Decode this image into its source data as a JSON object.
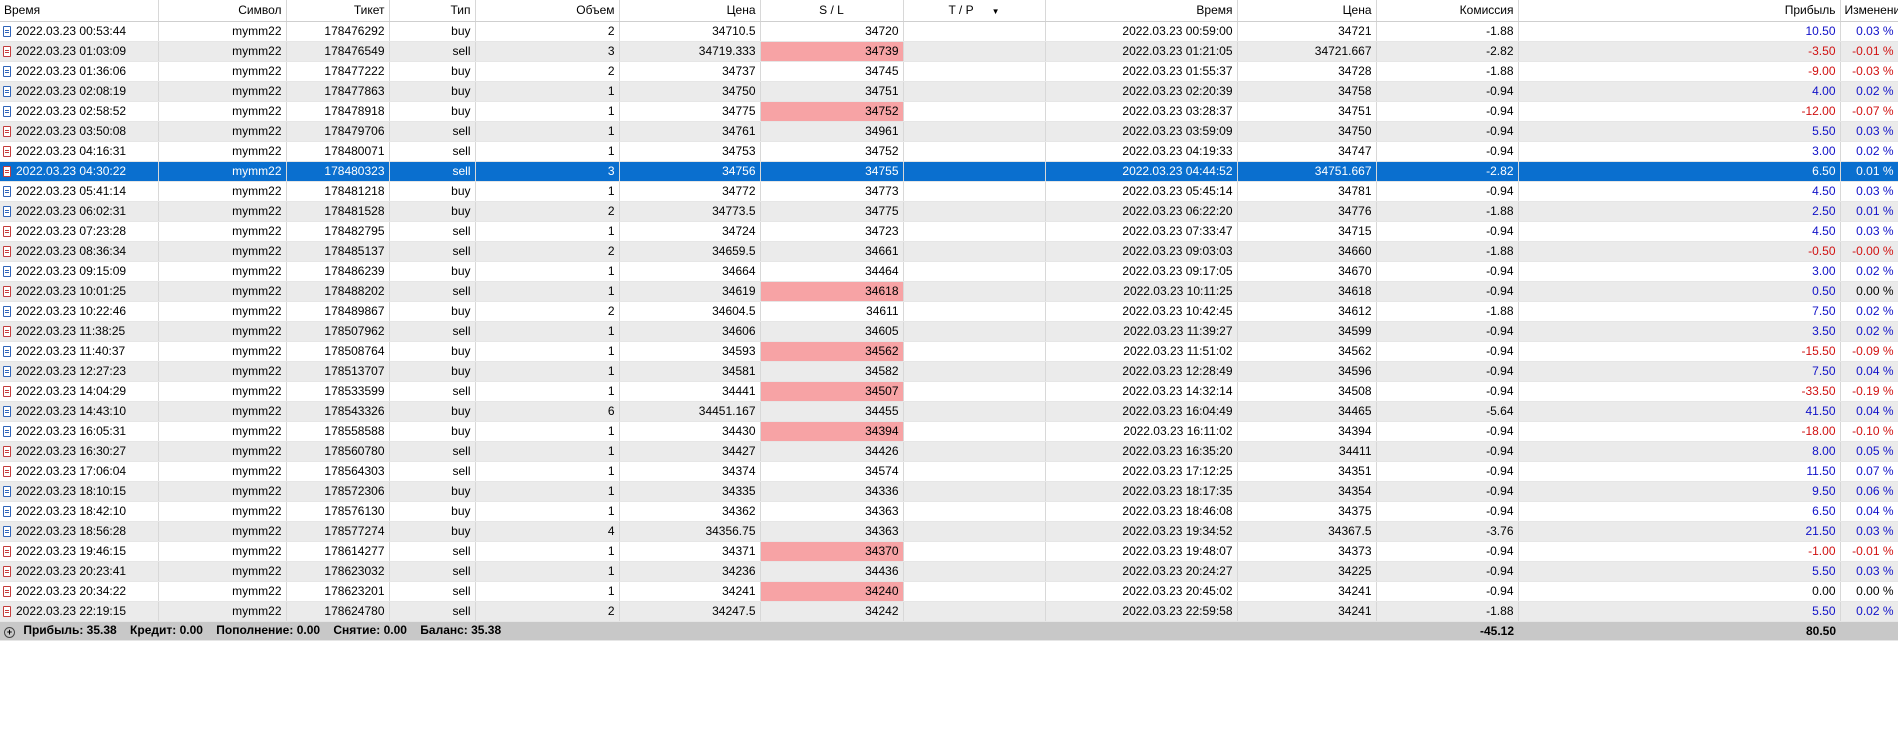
{
  "columns": {
    "time": "Время",
    "symbol": "Символ",
    "ticket": "Тикет",
    "type": "Тип",
    "volume": "Объем",
    "price": "Цена",
    "sl": "S / L",
    "tp": "T / P",
    "close_time": "Время",
    "close_price": "Цена",
    "commission": "Комиссия",
    "profit": "Прибыль",
    "change": "Изменение"
  },
  "rows": [
    {
      "time": "2022.03.23 00:53:44",
      "symbol": "mymm22",
      "ticket": "178476292",
      "type": "buy",
      "volume": "2",
      "price": "34710.5",
      "sl": "34720",
      "tp": "",
      "close_time": "2022.03.23 00:59:00",
      "close_price": "34721",
      "commission": "-1.88",
      "profit": "10.50",
      "change": "0.03 %"
    },
    {
      "time": "2022.03.23 01:03:09",
      "symbol": "mymm22",
      "ticket": "178476549",
      "type": "sell",
      "volume": "3",
      "price": "34719.333",
      "sl": "34739",
      "tp": "",
      "close_time": "2022.03.23 01:21:05",
      "close_price": "34721.667",
      "commission": "-2.82",
      "profit": "-3.50",
      "change": "-0.01 %",
      "sl_hit": true
    },
    {
      "time": "2022.03.23 01:36:06",
      "symbol": "mymm22",
      "ticket": "178477222",
      "type": "buy",
      "volume": "2",
      "price": "34737",
      "sl": "34745",
      "tp": "",
      "close_time": "2022.03.23 01:55:37",
      "close_price": "34728",
      "commission": "-1.88",
      "profit": "-9.00",
      "change": "-0.03 %"
    },
    {
      "time": "2022.03.23 02:08:19",
      "symbol": "mymm22",
      "ticket": "178477863",
      "type": "buy",
      "volume": "1",
      "price": "34750",
      "sl": "34751",
      "tp": "",
      "close_time": "2022.03.23 02:20:39",
      "close_price": "34758",
      "commission": "-0.94",
      "profit": "4.00",
      "change": "0.02 %"
    },
    {
      "time": "2022.03.23 02:58:52",
      "symbol": "mymm22",
      "ticket": "178478918",
      "type": "buy",
      "volume": "1",
      "price": "34775",
      "sl": "34752",
      "tp": "",
      "close_time": "2022.03.23 03:28:37",
      "close_price": "34751",
      "commission": "-0.94",
      "profit": "-12.00",
      "change": "-0.07 %",
      "sl_hit": true
    },
    {
      "time": "2022.03.23 03:50:08",
      "symbol": "mymm22",
      "ticket": "178479706",
      "type": "sell",
      "volume": "1",
      "price": "34761",
      "sl": "34961",
      "tp": "",
      "close_time": "2022.03.23 03:59:09",
      "close_price": "34750",
      "commission": "-0.94",
      "profit": "5.50",
      "change": "0.03 %"
    },
    {
      "time": "2022.03.23 04:16:31",
      "symbol": "mymm22",
      "ticket": "178480071",
      "type": "sell",
      "volume": "1",
      "price": "34753",
      "sl": "34752",
      "tp": "",
      "close_time": "2022.03.23 04:19:33",
      "close_price": "34747",
      "commission": "-0.94",
      "profit": "3.00",
      "change": "0.02 %"
    },
    {
      "time": "2022.03.23 04:30:22",
      "symbol": "mymm22",
      "ticket": "178480323",
      "type": "sell",
      "volume": "3",
      "price": "34756",
      "sl": "34755",
      "tp": "",
      "close_time": "2022.03.23 04:44:52",
      "close_price": "34751.667",
      "commission": "-2.82",
      "profit": "6.50",
      "change": "0.01 %",
      "selected": true
    },
    {
      "time": "2022.03.23 05:41:14",
      "symbol": "mymm22",
      "ticket": "178481218",
      "type": "buy",
      "volume": "1",
      "price": "34772",
      "sl": "34773",
      "tp": "",
      "close_time": "2022.03.23 05:45:14",
      "close_price": "34781",
      "commission": "-0.94",
      "profit": "4.50",
      "change": "0.03 %"
    },
    {
      "time": "2022.03.23 06:02:31",
      "symbol": "mymm22",
      "ticket": "178481528",
      "type": "buy",
      "volume": "2",
      "price": "34773.5",
      "sl": "34775",
      "tp": "",
      "close_time": "2022.03.23 06:22:20",
      "close_price": "34776",
      "commission": "-1.88",
      "profit": "2.50",
      "change": "0.01 %"
    },
    {
      "time": "2022.03.23 07:23:28",
      "symbol": "mymm22",
      "ticket": "178482795",
      "type": "sell",
      "volume": "1",
      "price": "34724",
      "sl": "34723",
      "tp": "",
      "close_time": "2022.03.23 07:33:47",
      "close_price": "34715",
      "commission": "-0.94",
      "profit": "4.50",
      "change": "0.03 %"
    },
    {
      "time": "2022.03.23 08:36:34",
      "symbol": "mymm22",
      "ticket": "178485137",
      "type": "sell",
      "volume": "2",
      "price": "34659.5",
      "sl": "34661",
      "tp": "",
      "close_time": "2022.03.23 09:03:03",
      "close_price": "34660",
      "commission": "-1.88",
      "profit": "-0.50",
      "change": "-0.00 %"
    },
    {
      "time": "2022.03.23 09:15:09",
      "symbol": "mymm22",
      "ticket": "178486239",
      "type": "buy",
      "volume": "1",
      "price": "34664",
      "sl": "34464",
      "tp": "",
      "close_time": "2022.03.23 09:17:05",
      "close_price": "34670",
      "commission": "-0.94",
      "profit": "3.00",
      "change": "0.02 %"
    },
    {
      "time": "2022.03.23 10:01:25",
      "symbol": "mymm22",
      "ticket": "178488202",
      "type": "sell",
      "volume": "1",
      "price": "34619",
      "sl": "34618",
      "tp": "",
      "close_time": "2022.03.23 10:11:25",
      "close_price": "34618",
      "commission": "-0.94",
      "profit": "0.50",
      "change": "0.00 %",
      "sl_hit": true
    },
    {
      "time": "2022.03.23 10:22:46",
      "symbol": "mymm22",
      "ticket": "178489867",
      "type": "buy",
      "volume": "2",
      "price": "34604.5",
      "sl": "34611",
      "tp": "",
      "close_time": "2022.03.23 10:42:45",
      "close_price": "34612",
      "commission": "-1.88",
      "profit": "7.50",
      "change": "0.02 %"
    },
    {
      "time": "2022.03.23 11:38:25",
      "symbol": "mymm22",
      "ticket": "178507962",
      "type": "sell",
      "volume": "1",
      "price": "34606",
      "sl": "34605",
      "tp": "",
      "close_time": "2022.03.23 11:39:27",
      "close_price": "34599",
      "commission": "-0.94",
      "profit": "3.50",
      "change": "0.02 %"
    },
    {
      "time": "2022.03.23 11:40:37",
      "symbol": "mymm22",
      "ticket": "178508764",
      "type": "buy",
      "volume": "1",
      "price": "34593",
      "sl": "34562",
      "tp": "",
      "close_time": "2022.03.23 11:51:02",
      "close_price": "34562",
      "commission": "-0.94",
      "profit": "-15.50",
      "change": "-0.09 %",
      "sl_hit": true
    },
    {
      "time": "2022.03.23 12:27:23",
      "symbol": "mymm22",
      "ticket": "178513707",
      "type": "buy",
      "volume": "1",
      "price": "34581",
      "sl": "34582",
      "tp": "",
      "close_time": "2022.03.23 12:28:49",
      "close_price": "34596",
      "commission": "-0.94",
      "profit": "7.50",
      "change": "0.04 %"
    },
    {
      "time": "2022.03.23 14:04:29",
      "symbol": "mymm22",
      "ticket": "178533599",
      "type": "sell",
      "volume": "1",
      "price": "34441",
      "sl": "34507",
      "tp": "",
      "close_time": "2022.03.23 14:32:14",
      "close_price": "34508",
      "commission": "-0.94",
      "profit": "-33.50",
      "change": "-0.19 %",
      "sl_hit": true
    },
    {
      "time": "2022.03.23 14:43:10",
      "symbol": "mymm22",
      "ticket": "178543326",
      "type": "buy",
      "volume": "6",
      "price": "34451.167",
      "sl": "34455",
      "tp": "",
      "close_time": "2022.03.23 16:04:49",
      "close_price": "34465",
      "commission": "-5.64",
      "profit": "41.50",
      "change": "0.04 %"
    },
    {
      "time": "2022.03.23 16:05:31",
      "symbol": "mymm22",
      "ticket": "178558588",
      "type": "buy",
      "volume": "1",
      "price": "34430",
      "sl": "34394",
      "tp": "",
      "close_time": "2022.03.23 16:11:02",
      "close_price": "34394",
      "commission": "-0.94",
      "profit": "-18.00",
      "change": "-0.10 %",
      "sl_hit": true
    },
    {
      "time": "2022.03.23 16:30:27",
      "symbol": "mymm22",
      "ticket": "178560780",
      "type": "sell",
      "volume": "1",
      "price": "34427",
      "sl": "34426",
      "tp": "",
      "close_time": "2022.03.23 16:35:20",
      "close_price": "34411",
      "commission": "-0.94",
      "profit": "8.00",
      "change": "0.05 %"
    },
    {
      "time": "2022.03.23 17:06:04",
      "symbol": "mymm22",
      "ticket": "178564303",
      "type": "sell",
      "volume": "1",
      "price": "34374",
      "sl": "34574",
      "tp": "",
      "close_time": "2022.03.23 17:12:25",
      "close_price": "34351",
      "commission": "-0.94",
      "profit": "11.50",
      "change": "0.07 %"
    },
    {
      "time": "2022.03.23 18:10:15",
      "symbol": "mymm22",
      "ticket": "178572306",
      "type": "buy",
      "volume": "1",
      "price": "34335",
      "sl": "34336",
      "tp": "",
      "close_time": "2022.03.23 18:17:35",
      "close_price": "34354",
      "commission": "-0.94",
      "profit": "9.50",
      "change": "0.06 %"
    },
    {
      "time": "2022.03.23 18:42:10",
      "symbol": "mymm22",
      "ticket": "178576130",
      "type": "buy",
      "volume": "1",
      "price": "34362",
      "sl": "34363",
      "tp": "",
      "close_time": "2022.03.23 18:46:08",
      "close_price": "34375",
      "commission": "-0.94",
      "profit": "6.50",
      "change": "0.04 %"
    },
    {
      "time": "2022.03.23 18:56:28",
      "symbol": "mymm22",
      "ticket": "178577274",
      "type": "buy",
      "volume": "4",
      "price": "34356.75",
      "sl": "34363",
      "tp": "",
      "close_time": "2022.03.23 19:34:52",
      "close_price": "34367.5",
      "commission": "-3.76",
      "profit": "21.50",
      "change": "0.03 %"
    },
    {
      "time": "2022.03.23 19:46:15",
      "symbol": "mymm22",
      "ticket": "178614277",
      "type": "sell",
      "volume": "1",
      "price": "34371",
      "sl": "34370",
      "tp": "",
      "close_time": "2022.03.23 19:48:07",
      "close_price": "34373",
      "commission": "-0.94",
      "profit": "-1.00",
      "change": "-0.01 %",
      "sl_hit": true
    },
    {
      "time": "2022.03.23 20:23:41",
      "symbol": "mymm22",
      "ticket": "178623032",
      "type": "sell",
      "volume": "1",
      "price": "34236",
      "sl": "34436",
      "tp": "",
      "close_time": "2022.03.23 20:24:27",
      "close_price": "34225",
      "commission": "-0.94",
      "profit": "5.50",
      "change": "0.03 %"
    },
    {
      "time": "2022.03.23 20:34:22",
      "symbol": "mymm22",
      "ticket": "178623201",
      "type": "sell",
      "volume": "1",
      "price": "34241",
      "sl": "34240",
      "tp": "",
      "close_time": "2022.03.23 20:45:02",
      "close_price": "34241",
      "commission": "-0.94",
      "profit": "0.00",
      "change": "0.00 %",
      "sl_hit": true
    },
    {
      "time": "2022.03.23 22:19:15",
      "symbol": "mymm22",
      "ticket": "178624780",
      "type": "sell",
      "volume": "2",
      "price": "34247.5",
      "sl": "34242",
      "tp": "",
      "close_time": "2022.03.23 22:59:58",
      "close_price": "34241",
      "commission": "-1.88",
      "profit": "5.50",
      "change": "0.02 %"
    }
  ],
  "footer": {
    "profit": "Прибыль: 35.38",
    "credit": "Кредит: 0.00",
    "deposit": "Пополнение: 0.00",
    "withdrawal": "Снятие: 0.00",
    "balance": "Баланс: 35.38",
    "commission_total": "-45.12",
    "profit_total": "80.50"
  },
  "colors": {
    "selected_row": "#0a6fcf",
    "sl_hit_cell": "#f7a3a5",
    "positive": "#1010c8",
    "negative": "#d01010",
    "buy_icon": "#2e63b8",
    "sell_icon": "#c43b3b"
  },
  "icons": {
    "buy": "buy-order-icon",
    "sell": "sell-order-icon",
    "sort": "sort-descending-icon",
    "expand": "expand-plus-icon"
  }
}
